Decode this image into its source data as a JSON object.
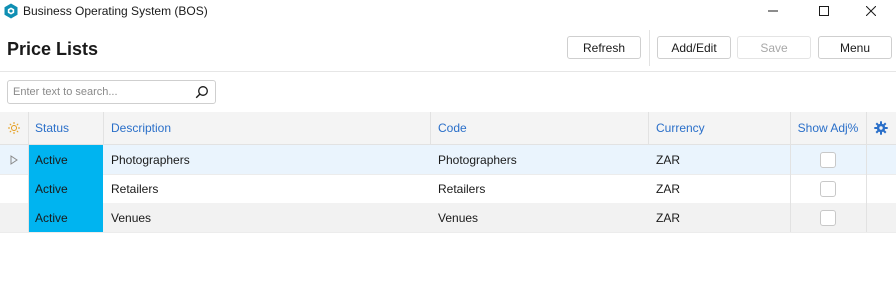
{
  "window": {
    "title": "Business Operating System (BOS)",
    "accent_color": "#0f8fb3"
  },
  "page": {
    "title": "Price Lists"
  },
  "toolbar": {
    "refresh_label": "Refresh",
    "add_edit_label": "Add/Edit",
    "save_label": "Save",
    "menu_label": "Menu"
  },
  "search": {
    "placeholder": "Enter text to search...",
    "value": ""
  },
  "grid": {
    "columns": [
      "Status",
      "Description",
      "Code",
      "Currency",
      "Show Adj%"
    ],
    "status_color": "#00b4f0",
    "header_color": "#2a6fc9",
    "rows": [
      {
        "status": "Active",
        "description": "Photographers",
        "code": "Photographers",
        "currency": "ZAR",
        "show_adj": false
      },
      {
        "status": "Active",
        "description": "Retailers",
        "code": "Retailers",
        "currency": "ZAR",
        "show_adj": false
      },
      {
        "status": "Active",
        "description": "Venues",
        "code": "Venues",
        "currency": "ZAR",
        "show_adj": false
      }
    ]
  },
  "icons": {
    "app": "hexagon-logo-icon",
    "header_indicator": "sun-icon",
    "settings": "gear-icon",
    "search": "search-icon",
    "row_pointer": "triangle-right-icon"
  }
}
